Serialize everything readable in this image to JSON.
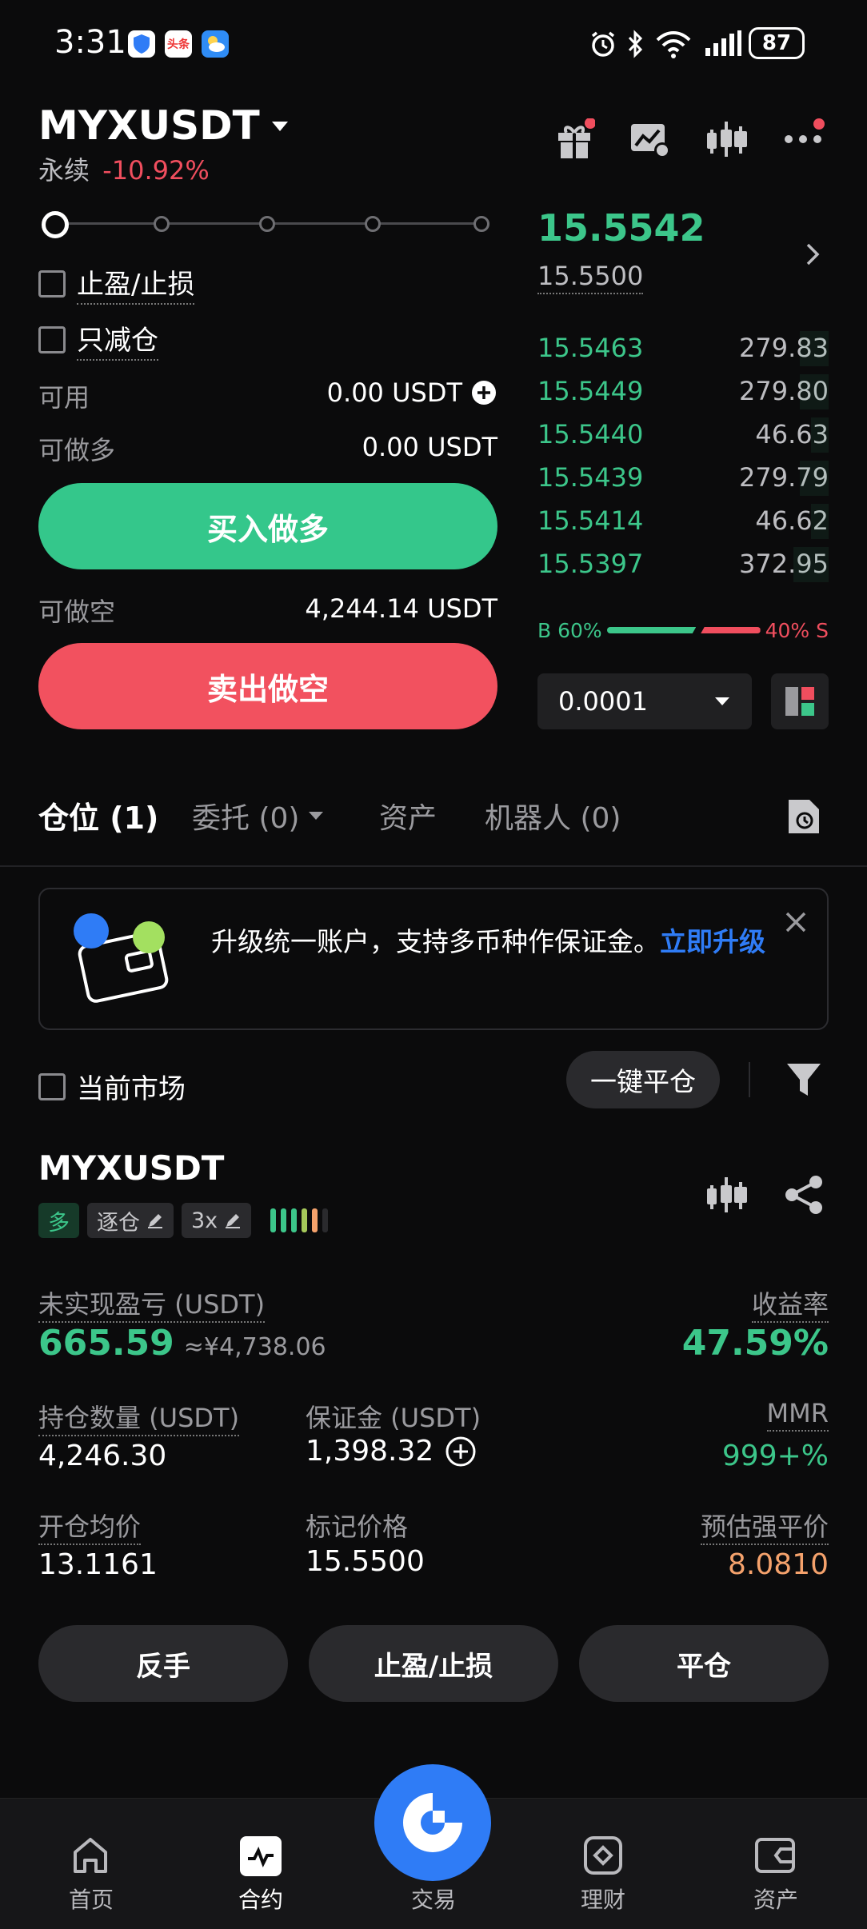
{
  "status_bar": {
    "time": "3:31",
    "battery": "87",
    "app_badge": "头条"
  },
  "header": {
    "symbol": "MYXUSDT",
    "contract_type": "永续",
    "change_pct": "-10.92%"
  },
  "order_form": {
    "tp_sl_label": "止盈/止损",
    "reduce_only_label": "只减仓",
    "available_label": "可用",
    "available_value": "0.00 USDT",
    "can_long_label": "可做多",
    "can_long_value": "0.00 USDT",
    "buy_button": "买入做多",
    "can_short_label": "可做空",
    "can_short_value": "4,244.14 USDT",
    "sell_button": "卖出做空"
  },
  "orderbook": {
    "last_price": "15.5542",
    "mark_price": "15.5500",
    "bids": [
      {
        "price": "15.5463",
        "size": "279.83",
        "depth": 0.1
      },
      {
        "price": "15.5449",
        "size": "279.80",
        "depth": 0.1
      },
      {
        "price": "15.5440",
        "size": "46.63",
        "depth": 0.06
      },
      {
        "price": "15.5439",
        "size": "279.79",
        "depth": 0.1
      },
      {
        "price": "15.5414",
        "size": "46.62",
        "depth": 0.06
      },
      {
        "price": "15.5397",
        "size": "372.95",
        "depth": 0.12
      }
    ],
    "buy_ratio_label": "B 60%",
    "sell_ratio_label": "40% S",
    "buy_ratio": 0.6,
    "precision": "0.0001"
  },
  "tabs": [
    {
      "label": "仓位 (1)"
    },
    {
      "label": "委托 (0)"
    },
    {
      "label": "资产"
    },
    {
      "label": "机器人 (0)"
    }
  ],
  "banner": {
    "text": "升级统一账户，支持多币种作保证金。",
    "link": "立即升级"
  },
  "filter": {
    "current_market_label": "当前市场",
    "close_all_button": "一键平仓"
  },
  "position": {
    "symbol": "MYXUSDT",
    "side_tag": "多",
    "margin_mode_tag": "逐仓",
    "leverage_tag": "3x",
    "unrealized_pnl_label": "未实现盈亏 (USDT)",
    "unrealized_pnl": "665.59",
    "unrealized_pnl_cny": "≈¥4,738.06",
    "roe_label": "收益率",
    "roe": "47.59%",
    "size_label": "持仓数量 (USDT)",
    "size": "4,246.30",
    "margin_label": "保证金 (USDT)",
    "margin": "1,398.32",
    "mmr_label": "MMR",
    "mmr": "999+%",
    "entry_label": "开仓均价",
    "entry": "13.1161",
    "mark_label": "标记价格",
    "mark": "15.5500",
    "liq_label": "预估强平价",
    "liq": "8.0810",
    "reverse_button": "反手",
    "tpsl_button": "止盈/止损",
    "close_button": "平仓"
  },
  "bottom_nav": [
    {
      "label": "首页"
    },
    {
      "label": "合约"
    },
    {
      "label": "交易"
    },
    {
      "label": "理财"
    },
    {
      "label": "资产"
    }
  ],
  "colors": {
    "green": "#3cc68a",
    "red": "#f04e5e",
    "orange": "#f5a26c",
    "blue": "#2f7cf6"
  }
}
